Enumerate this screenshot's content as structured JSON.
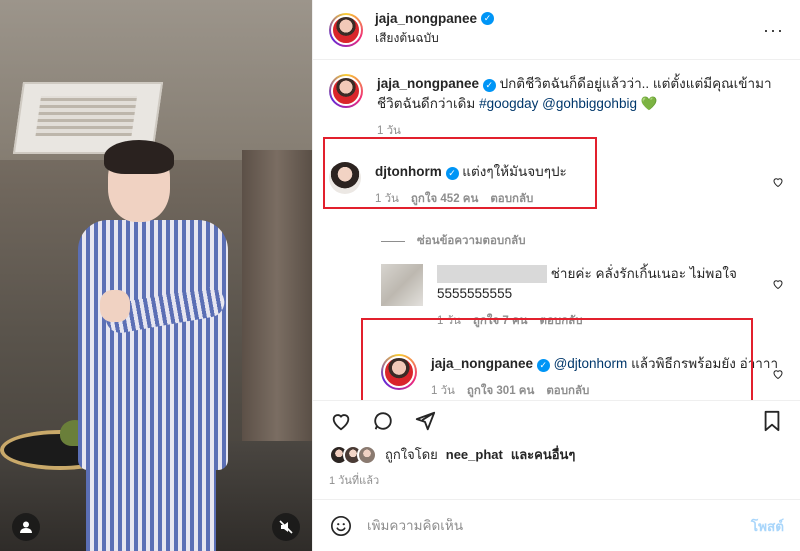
{
  "post": {
    "username": "jaja_nongpanee",
    "subtitle": "เสียงต้นฉบับ",
    "more_icon": "more-dots-icon"
  },
  "caption": {
    "username": "jaja_nongpanee",
    "text": "ปกติชีวิตฉันก็ดีอยู่แล้วว่า.. แต่ตั้งแต่มีคุณเข้ามา ชีวิตฉันดีกว่าเดิม",
    "hashtag": "#googday",
    "mention": "@gohbiggohbig",
    "emoji": "💚",
    "time": "1 วัน"
  },
  "comments": [
    {
      "username": "djtonhorm",
      "text": "แต่งๆให้มันจบๆปะ",
      "time": "1 วัน",
      "likes": "ถูกใจ 452 คน",
      "reply": "ตอบกลับ"
    }
  ],
  "hide_replies": "ซ่อนข้อความตอบกลับ",
  "replies": [
    {
      "text": "ช่ายค่ะ คลั่งรักเกิ้นเนอะ ไม่พอใจ 5555555555",
      "time": "1 วัน",
      "likes": "ถูกใจ 7 คน",
      "reply": "ตอบกลับ"
    },
    {
      "username": "jaja_nongpanee",
      "mention": "@djtonhorm",
      "text": "แล้วพิธีกรพร้อมยัง อ่าาาา",
      "time": "1 วัน",
      "likes": "ถูกใจ 301 คน",
      "reply": "ตอบกลับ"
    }
  ],
  "likes_line": {
    "prefix": "ถูกใจโดย",
    "user": "nee_phat",
    "suffix": "และคนอื่นๆ"
  },
  "date": "1 วันที่แล้ว",
  "composer": {
    "placeholder": "เพิ่มความคิดเห็น",
    "post_label": "โพสต์"
  },
  "colors": {
    "verified": "#0095f6",
    "highlight": "#e2202d",
    "link": "#00376b",
    "post_button": "#a9d6fb",
    "emoji_heart": "#2ecc40"
  }
}
